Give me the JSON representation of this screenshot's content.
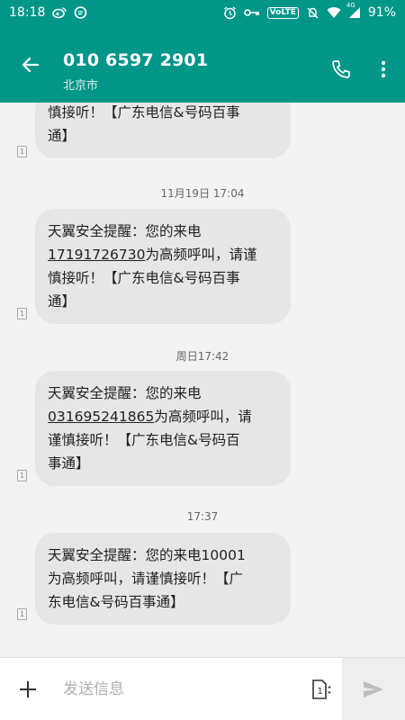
{
  "status_bar": {
    "time": "18:18",
    "network_badge": "VoLTE",
    "signal_label": "4G",
    "battery": "91%",
    "icons": [
      "weibo-icon",
      "message-bubble-icon",
      "alarm-icon",
      "key-icon",
      "mute-icon",
      "wifi-icon",
      "signal-icon",
      "battery-icon"
    ]
  },
  "header": {
    "title": "010 6597 2901",
    "subtitle": "北京市"
  },
  "messages": [
    {
      "lines": [
        "慎接听！【广东电信&号码百事",
        "通】"
      ],
      "sim": "1"
    },
    {
      "timestamp": "11月19日 17:04",
      "lines_html": [
        "天翼安全提醒：您的来电",
        "__N__为高频呼叫，请谨",
        "慎接听！【广东电信&号码百事",
        "通】"
      ],
      "number": "17191726730",
      "sim": "1"
    },
    {
      "timestamp": "周日17:42",
      "lines_html": [
        "天翼安全提醒：您的来电",
        "__N__为高频呼叫，请",
        "谨慎接听！【广东电信&号码百",
        "事通】"
      ],
      "number": "031695241865",
      "sim": "1"
    },
    {
      "timestamp": "17:37",
      "lines": [
        "天翼安全提醒：您的来电10001",
        "为高频呼叫，请谨慎接听！【广",
        "东电信&号码百事通】"
      ],
      "sim": "1"
    }
  ],
  "composer": {
    "placeholder": "发送信息",
    "sim_slot": "1"
  },
  "colors": {
    "primary": "#009688",
    "bubble": "#e6e6e6",
    "background": "#f3f3f3"
  }
}
